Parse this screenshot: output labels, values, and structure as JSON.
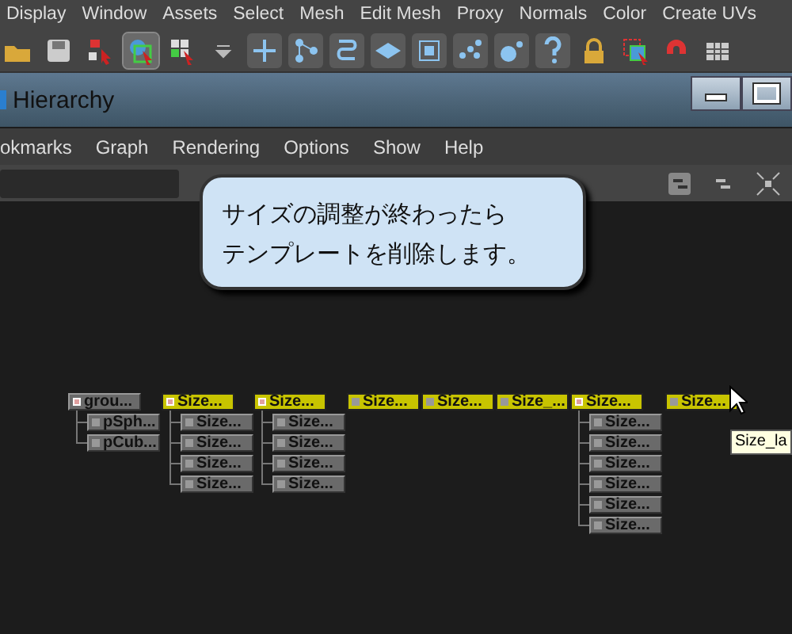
{
  "main_menu": [
    "Display",
    "Window",
    "Assets",
    "Select",
    "Mesh",
    "Edit Mesh",
    "Proxy",
    "Normals",
    "Color",
    "Create UVs"
  ],
  "window": {
    "title": "Hierarchy"
  },
  "window_menu": [
    "okmarks",
    "Graph",
    "Rendering",
    "Options",
    "Show",
    "Help"
  ],
  "callout": {
    "lines": [
      "サイズの調整が終わったら",
      "テンプレートを削除します。"
    ]
  },
  "nodes": [
    {
      "label": "grou...",
      "kind": "group",
      "selected": false,
      "children": [
        {
          "label": "pSph...",
          "kind": "shape",
          "selected": false
        },
        {
          "label": "pCub...",
          "kind": "shape",
          "selected": false
        }
      ]
    },
    {
      "label": "Size...",
      "kind": "group",
      "selected": true,
      "children": [
        {
          "label": "Size...",
          "kind": "shape",
          "selected": false
        },
        {
          "label": "Size...",
          "kind": "shape",
          "selected": false
        },
        {
          "label": "Size...",
          "kind": "shape",
          "selected": false
        },
        {
          "label": "Size...",
          "kind": "shape",
          "selected": false
        }
      ]
    },
    {
      "label": "Size...",
      "kind": "group",
      "selected": true,
      "children": [
        {
          "label": "Size...",
          "kind": "shape",
          "selected": false
        },
        {
          "label": "Size...",
          "kind": "shape",
          "selected": false
        },
        {
          "label": "Size...",
          "kind": "shape",
          "selected": false
        },
        {
          "label": "Size...",
          "kind": "shape",
          "selected": false
        }
      ]
    },
    {
      "label": "Size...",
      "kind": "shape",
      "selected": true
    },
    {
      "label": "Size...",
      "kind": "shape",
      "selected": true
    },
    {
      "label": "Size_...",
      "kind": "shape",
      "selected": true
    },
    {
      "label": "Size...",
      "kind": "group",
      "selected": true,
      "children": [
        {
          "label": "Size...",
          "kind": "shape",
          "selected": false
        },
        {
          "label": "Size...",
          "kind": "shape",
          "selected": false
        },
        {
          "label": "Size...",
          "kind": "shape",
          "selected": false
        },
        {
          "label": "Size...",
          "kind": "shape",
          "selected": false
        },
        {
          "label": "Size...",
          "kind": "shape",
          "selected": false
        },
        {
          "label": "Size...",
          "kind": "shape",
          "selected": false
        }
      ]
    },
    {
      "label": "Size...",
      "kind": "shape",
      "selected": true
    }
  ],
  "tooltip": "Size_la"
}
